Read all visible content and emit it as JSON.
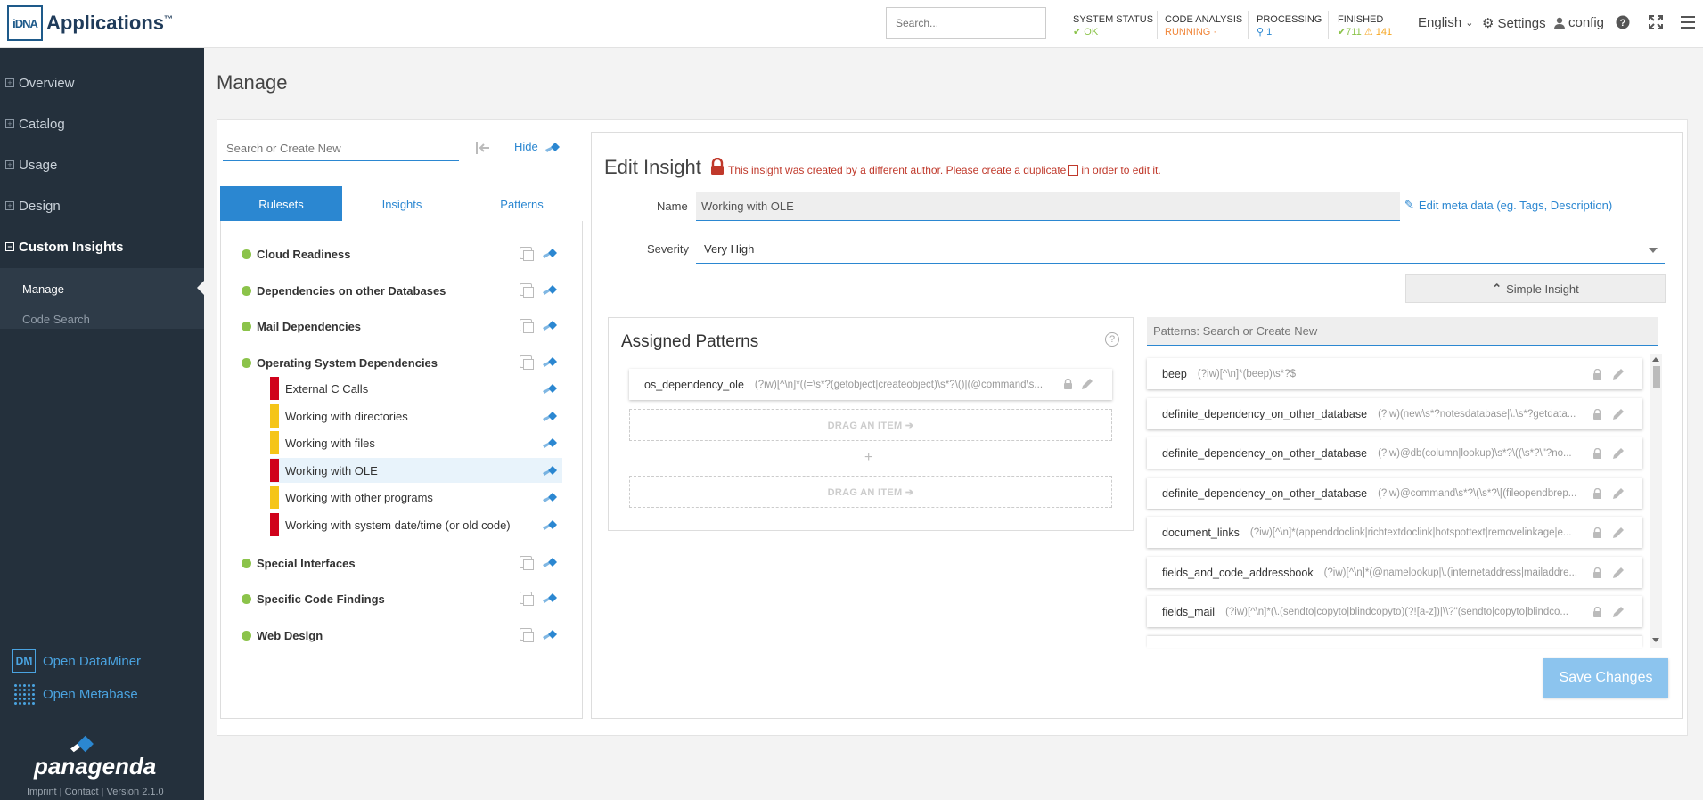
{
  "header": {
    "app_name": "Applications",
    "logo_mark": "iDNA",
    "tm": "™",
    "search_placeholder": "Search...",
    "statuses": [
      {
        "label": "SYSTEM STATUS",
        "value": "OK",
        "color": "#8bc34a"
      },
      {
        "label": "CODE ANALYSIS",
        "value": "RUNNING",
        "color": "#f0863a"
      },
      {
        "label": "PROCESSING",
        "value": "1",
        "color": "#2b87d1"
      },
      {
        "label": "FINISHED",
        "ok_count": "711",
        "warn_count": "141",
        "ok_color": "#8bc34a",
        "warn_color": "#f5a623"
      }
    ],
    "language": "English",
    "settings_label": "Settings",
    "user_label": "config"
  },
  "sidebar": {
    "items": [
      {
        "label": "Overview"
      },
      {
        "label": "Catalog"
      },
      {
        "label": "Usage"
      },
      {
        "label": "Design"
      },
      {
        "label": "Custom Insights"
      }
    ],
    "sub_items": [
      {
        "label": "Manage"
      },
      {
        "label": "Code Search"
      }
    ],
    "external_links": [
      {
        "label": "Open DataMiner",
        "icon": "dataminer-icon",
        "icon_text": "DM"
      },
      {
        "label": "Open Metabase",
        "icon": "metabase-icon"
      }
    ],
    "brand": "panagenda",
    "footer": "Imprint | Contact | Version 2.1.0"
  },
  "page": {
    "title": "Manage"
  },
  "left_panel": {
    "search_placeholder": "Search or Create New",
    "hide_label": "Hide",
    "tabs": [
      {
        "label": "Rulesets"
      },
      {
        "label": "Insights"
      },
      {
        "label": "Patterns"
      }
    ],
    "rulesets": [
      {
        "name": "Cloud Readiness"
      },
      {
        "name": "Dependencies on other Databases"
      },
      {
        "name": "Mail Dependencies"
      },
      {
        "name": "Operating System Dependencies"
      },
      {
        "name": "Special Interfaces"
      },
      {
        "name": "Specific Code Findings"
      },
      {
        "name": "Web Design"
      }
    ],
    "insights": [
      {
        "name": "External C Calls",
        "color": "#d0021b"
      },
      {
        "name": "Working with directories",
        "color": "#f5c518"
      },
      {
        "name": "Working with files",
        "color": "#f5c518"
      },
      {
        "name": "Working with OLE",
        "color": "#d0021b"
      },
      {
        "name": "Working with other programs",
        "color": "#f5c518"
      },
      {
        "name": "Working with system date/time (or old code)",
        "color": "#d0021b"
      }
    ]
  },
  "edit": {
    "title": "Edit Insight",
    "warning_before": "This insight was created by a different author. Please create a duplicate",
    "warning_after": "in order to edit it.",
    "name_label": "Name",
    "name_value": "Working with OLE",
    "meta_link": "Edit meta data (eg. Tags, Description)",
    "severity_label": "Severity",
    "severity_value": "Very High",
    "simple_insight_label": "Simple Insight",
    "assigned_title": "Assigned Patterns",
    "assigned": [
      {
        "name": "os_dependency_ole",
        "expr": "(?iw)[^\\n]*((=\\s*?(getobject|createobject)\\s*?\\()|(@command\\s..."
      }
    ],
    "drag_label": "DRAG AN ITEM ➔",
    "plus": "+",
    "patterns_search_placeholder": "Patterns: Search or Create New",
    "patterns": [
      {
        "name": "beep",
        "expr": "(?iw)[^\\n]*(beep)\\s*?$"
      },
      {
        "name": "definite_dependency_on_other_database",
        "expr": "(?iw)(new\\s*?notesdatabase|\\.\\s*?getdata..."
      },
      {
        "name": "definite_dependency_on_other_database",
        "expr": "(?iw)@db(column|lookup)\\s*?\\((\\s*?\\\"?no..."
      },
      {
        "name": "definite_dependency_on_other_database",
        "expr": "(?iw)@command\\s*?\\(\\s*?\\[(fileopendbrep..."
      },
      {
        "name": "document_links",
        "expr": "(?iw)[^\\n]*(appenddoclink|richtextdoclink|hotspottext|removelinkage|e..."
      },
      {
        "name": "fields_and_code_addressbook",
        "expr": "(?iw)[^\\n]*(@namelookup|\\.(internetaddress|mailaddre..."
      },
      {
        "name": "fields_mail",
        "expr": "(?iw)[^\\n]*(\\.(sendto|copyto|blindcopyto)(?![a-z])|\\\\?\"(sendto|copyto|blindco..."
      }
    ],
    "save_label": "Save Changes"
  }
}
